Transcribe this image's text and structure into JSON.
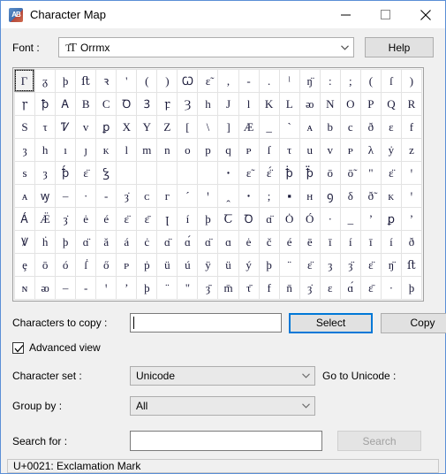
{
  "window": {
    "title": "Character Map",
    "app_icon": "charmap-icon",
    "minimize": "minimize-icon",
    "maximize": "maximize-icon",
    "close": "close-icon"
  },
  "font": {
    "label": "Font :",
    "icon": "truetype-icon",
    "value": "Orrmx",
    "arrow": "chevron-down-icon",
    "help_label": "Help"
  },
  "grid": {
    "columns": 20,
    "rows": 10,
    "selected_index": 0,
    "cells": [
      "Γ",
      "ᵹ",
      "þ",
      "ﬅ",
      "ꝛ",
      "'",
      "(",
      ")",
      "Ꞷ",
      "ɛ̃",
      ",",
      "-",
      ".",
      "ˡ",
      "ŋ̈",
      ":",
      ";",
      "(",
      "ſ",
      ")",
      "ꞅ",
      "ꝥ",
      "Ꭺ",
      "B",
      "C",
      "Ꝺ",
      "Ꝫ",
      "ꝼ",
      "Ȝ",
      "h",
      "J",
      "l",
      "K",
      "L",
      "ᴔ",
      "N",
      "O",
      "P",
      "Q",
      "R",
      "S",
      "τ",
      "Ꮴ",
      "ᴠ",
      "ꝑ",
      "X",
      "Y",
      "Z",
      "[",
      "\\",
      "]",
      "Æ",
      "_",
      "`",
      "ᴀ",
      "b",
      "c",
      "ð",
      "ɛ",
      "f",
      "ȝ",
      "h",
      "ı",
      "ȷ",
      "ᴋ",
      "l",
      "m",
      "n",
      "ᴏ",
      "p",
      "q",
      "ᴘ",
      "ſ",
      "τ",
      "u",
      "ᴠ",
      "ᴘ",
      "λ",
      "ẏ",
      "ᴢ",
      "s",
      "ȝ",
      "ꝥ́",
      "ɛ̈",
      "Ꝣ",
      "",
      "",
      "",
      "",
      "",
      "ꞏ",
      "ɛ̃",
      "ɛ̈́",
      "ꝥ̇",
      "ꝥ̈",
      "ō",
      "ō̃",
      "\"",
      "ɛ̈",
      "ꞌ",
      "ᴀ",
      "ꝡ",
      "–",
      "·",
      "-",
      "ȝ̇",
      "ᴄ",
      "ᴦ",
      "´",
      "ꞌ",
      "ꞈ",
      "ꞏ",
      ";",
      "▪",
      "ʜ",
      "ꝯ",
      "δ",
      "ð̃",
      "ᴋ",
      "ꞌ",
      "Ꭺ́",
      "Æ̈",
      "ȝ̇",
      "ė",
      "é",
      "ɛ̈",
      "ɛ̄",
      "ꞁ",
      "í",
      "þ",
      "Ꞇ",
      "Ꝺ",
      "ɑ̈",
      "Ȯ",
      "Ó",
      "·",
      "_",
      "ʼ",
      "ꝑ",
      "ʼ",
      "Ꝟ",
      "ḣ",
      "þ",
      "ɑ̈",
      "ă",
      "á",
      "ċ",
      "ɑ̈",
      "ɑ́",
      "ɑ̈",
      "ɑ",
      "ė",
      "č",
      "é",
      "ē",
      "ī",
      "í",
      "ī",
      "í",
      "ð",
      "ȩ",
      "ō",
      "ó",
      "ẛ",
      "ő",
      "ᴘ",
      "ṗ",
      "ü",
      "ú",
      "ÿ",
      "ü",
      "ý",
      "þ",
      "¨",
      "ɛ̈",
      "ȝ",
      "ȝ̈",
      "ɛ̈",
      "ŋ̈",
      "ﬅ",
      "ɴ",
      "ᴔ",
      "–",
      "-",
      "ꞌ",
      "ʼ",
      "þ",
      "¨",
      "\"",
      "ȝ̄",
      "m̄",
      "τ̄",
      "f",
      "n̄",
      "ȝ̇",
      "ɛ",
      "ɑ́",
      "ɛ̄",
      "·",
      "þ"
    ]
  },
  "characters_to_copy": {
    "label": "Characters to copy :",
    "value": "",
    "select_label": "Select",
    "copy_label": "Copy"
  },
  "advanced_view": {
    "label": "Advanced view",
    "checked": true,
    "check_icon": "checkmark-icon"
  },
  "character_set": {
    "label": "Character set :",
    "value": "Unicode",
    "arrow": "chevron-down-icon"
  },
  "go_to_unicode": {
    "label": "Go to Unicode :",
    "value": ""
  },
  "group_by": {
    "label": "Group by :",
    "value": "All",
    "arrow": "chevron-down-icon"
  },
  "search": {
    "label": "Search for :",
    "value": "",
    "button_label": "Search",
    "button_disabled": true
  },
  "status": {
    "text": "U+0021: Exclamation Mark"
  },
  "colors": {
    "window_border": "#5b8fd6",
    "face": "#f0f0f0",
    "accent": "#0078d7",
    "glyph": "#1a1a3a"
  }
}
